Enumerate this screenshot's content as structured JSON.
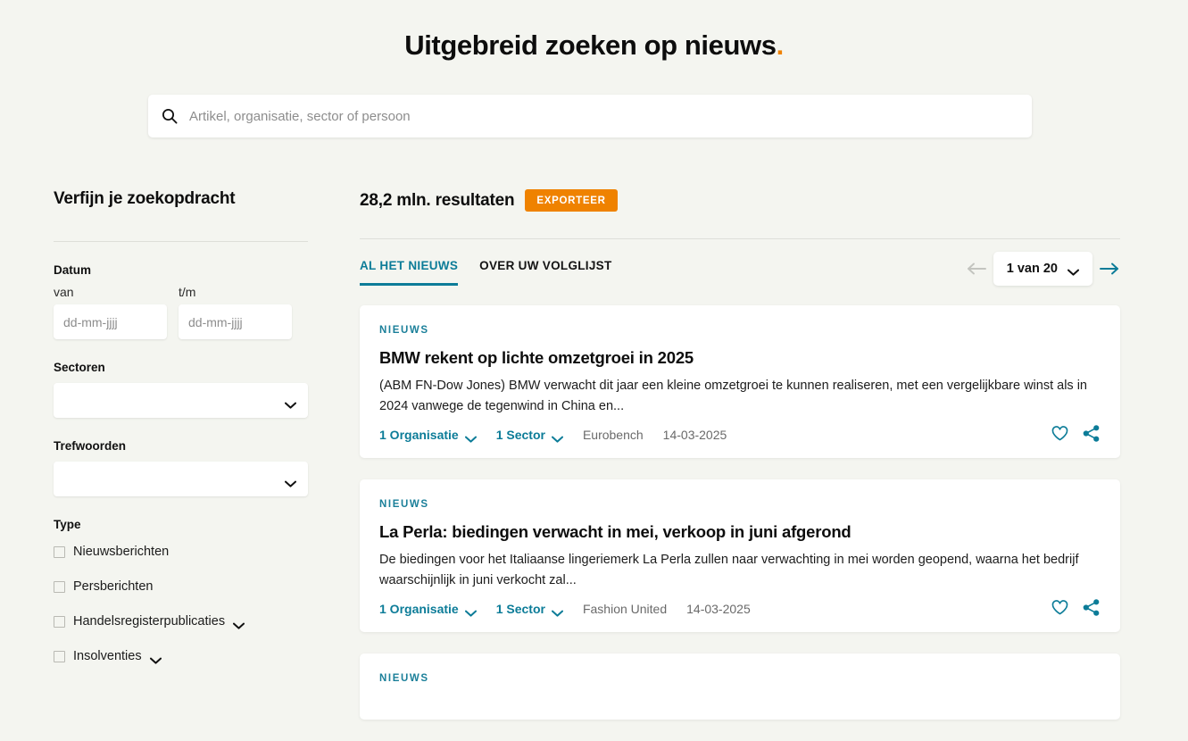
{
  "header": {
    "title": "Uitgebreid zoeken op nieuws",
    "title_dot": "."
  },
  "search": {
    "icon": "search-icon",
    "placeholder": "Artikel, organisatie, sector of persoon",
    "value": ""
  },
  "sidebar": {
    "title": "Verfijn je zoekopdracht",
    "date": {
      "label": "Datum",
      "from_label": "van",
      "from_placeholder": "dd-mm-jjjj",
      "from_value": "",
      "to_label": "t/m",
      "to_placeholder": "dd-mm-jjjj",
      "to_value": ""
    },
    "sectors": {
      "label": "Sectoren",
      "value": ""
    },
    "keywords": {
      "label": "Trefwoorden",
      "value": ""
    },
    "type": {
      "label": "Type",
      "options": [
        {
          "label": "Nieuwsberichten",
          "checked": false,
          "expandable": false
        },
        {
          "label": "Persberichten",
          "checked": false,
          "expandable": false
        },
        {
          "label": "Handelsregisterpublicaties",
          "checked": false,
          "expandable": true
        },
        {
          "label": "Insolventies",
          "checked": false,
          "expandable": true
        }
      ]
    }
  },
  "results": {
    "count_label": "28,2 mln. resultaten",
    "export_label": "EXPORTEER",
    "tabs": [
      {
        "label": "AL HET NIEUWS",
        "active": true
      },
      {
        "label": "OVER UW VOLGLIJST",
        "active": false
      }
    ],
    "pager": {
      "prev_icon": "arrow-left-icon",
      "next_icon": "arrow-right-icon",
      "page_label": "1 van 20"
    },
    "articles": [
      {
        "kicker": "NIEUWS",
        "title": "BMW rekent op lichte omzetgroei in 2025",
        "excerpt": "(ABM FN-Dow Jones) BMW verwacht dit jaar een kleine omzetgroei te kunnen realiseren, met een vergelijkbare winst als in 2024 vanwege de tegenwind in China en...",
        "organisations": "1 Organisatie",
        "sectors": "1 Sector",
        "source": "Eurobench",
        "date": "14-03-2025",
        "favorite_icon": "heart-icon",
        "share_icon": "share-icon"
      },
      {
        "kicker": "NIEUWS",
        "title": "La Perla: biedingen verwacht in mei, verkoop in juni afgerond",
        "excerpt": "De biedingen voor het Italiaanse lingeriemerk La Perla zullen naar verwachting in mei worden geopend, waarna het bedrijf waarschijnlijk in juni verkocht zal...",
        "organisations": "1 Organisatie",
        "sectors": "1 Sector",
        "source": "Fashion United",
        "date": "14-03-2025",
        "favorite_icon": "heart-icon",
        "share_icon": "share-icon"
      },
      {
        "kicker": "NIEUWS",
        "title": "",
        "excerpt": "",
        "organisations": "",
        "sectors": "",
        "source": "",
        "date": "",
        "favorite_icon": "heart-icon",
        "share_icon": "share-icon"
      }
    ]
  },
  "colors": {
    "background": "#f4f5f0",
    "accent_orange": "#ef8200",
    "accent_teal": "#0c7c98",
    "card": "#ffffff"
  }
}
